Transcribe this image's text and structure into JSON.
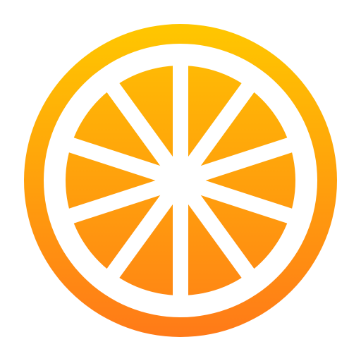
{
  "icon": {
    "name": "orange-slice-icon",
    "colors": {
      "gradient_top": "#FFC700",
      "gradient_bottom": "#FF7A18",
      "pith": "#FFFFFF",
      "background": "#FFFFFF"
    },
    "segment_count": 10
  }
}
